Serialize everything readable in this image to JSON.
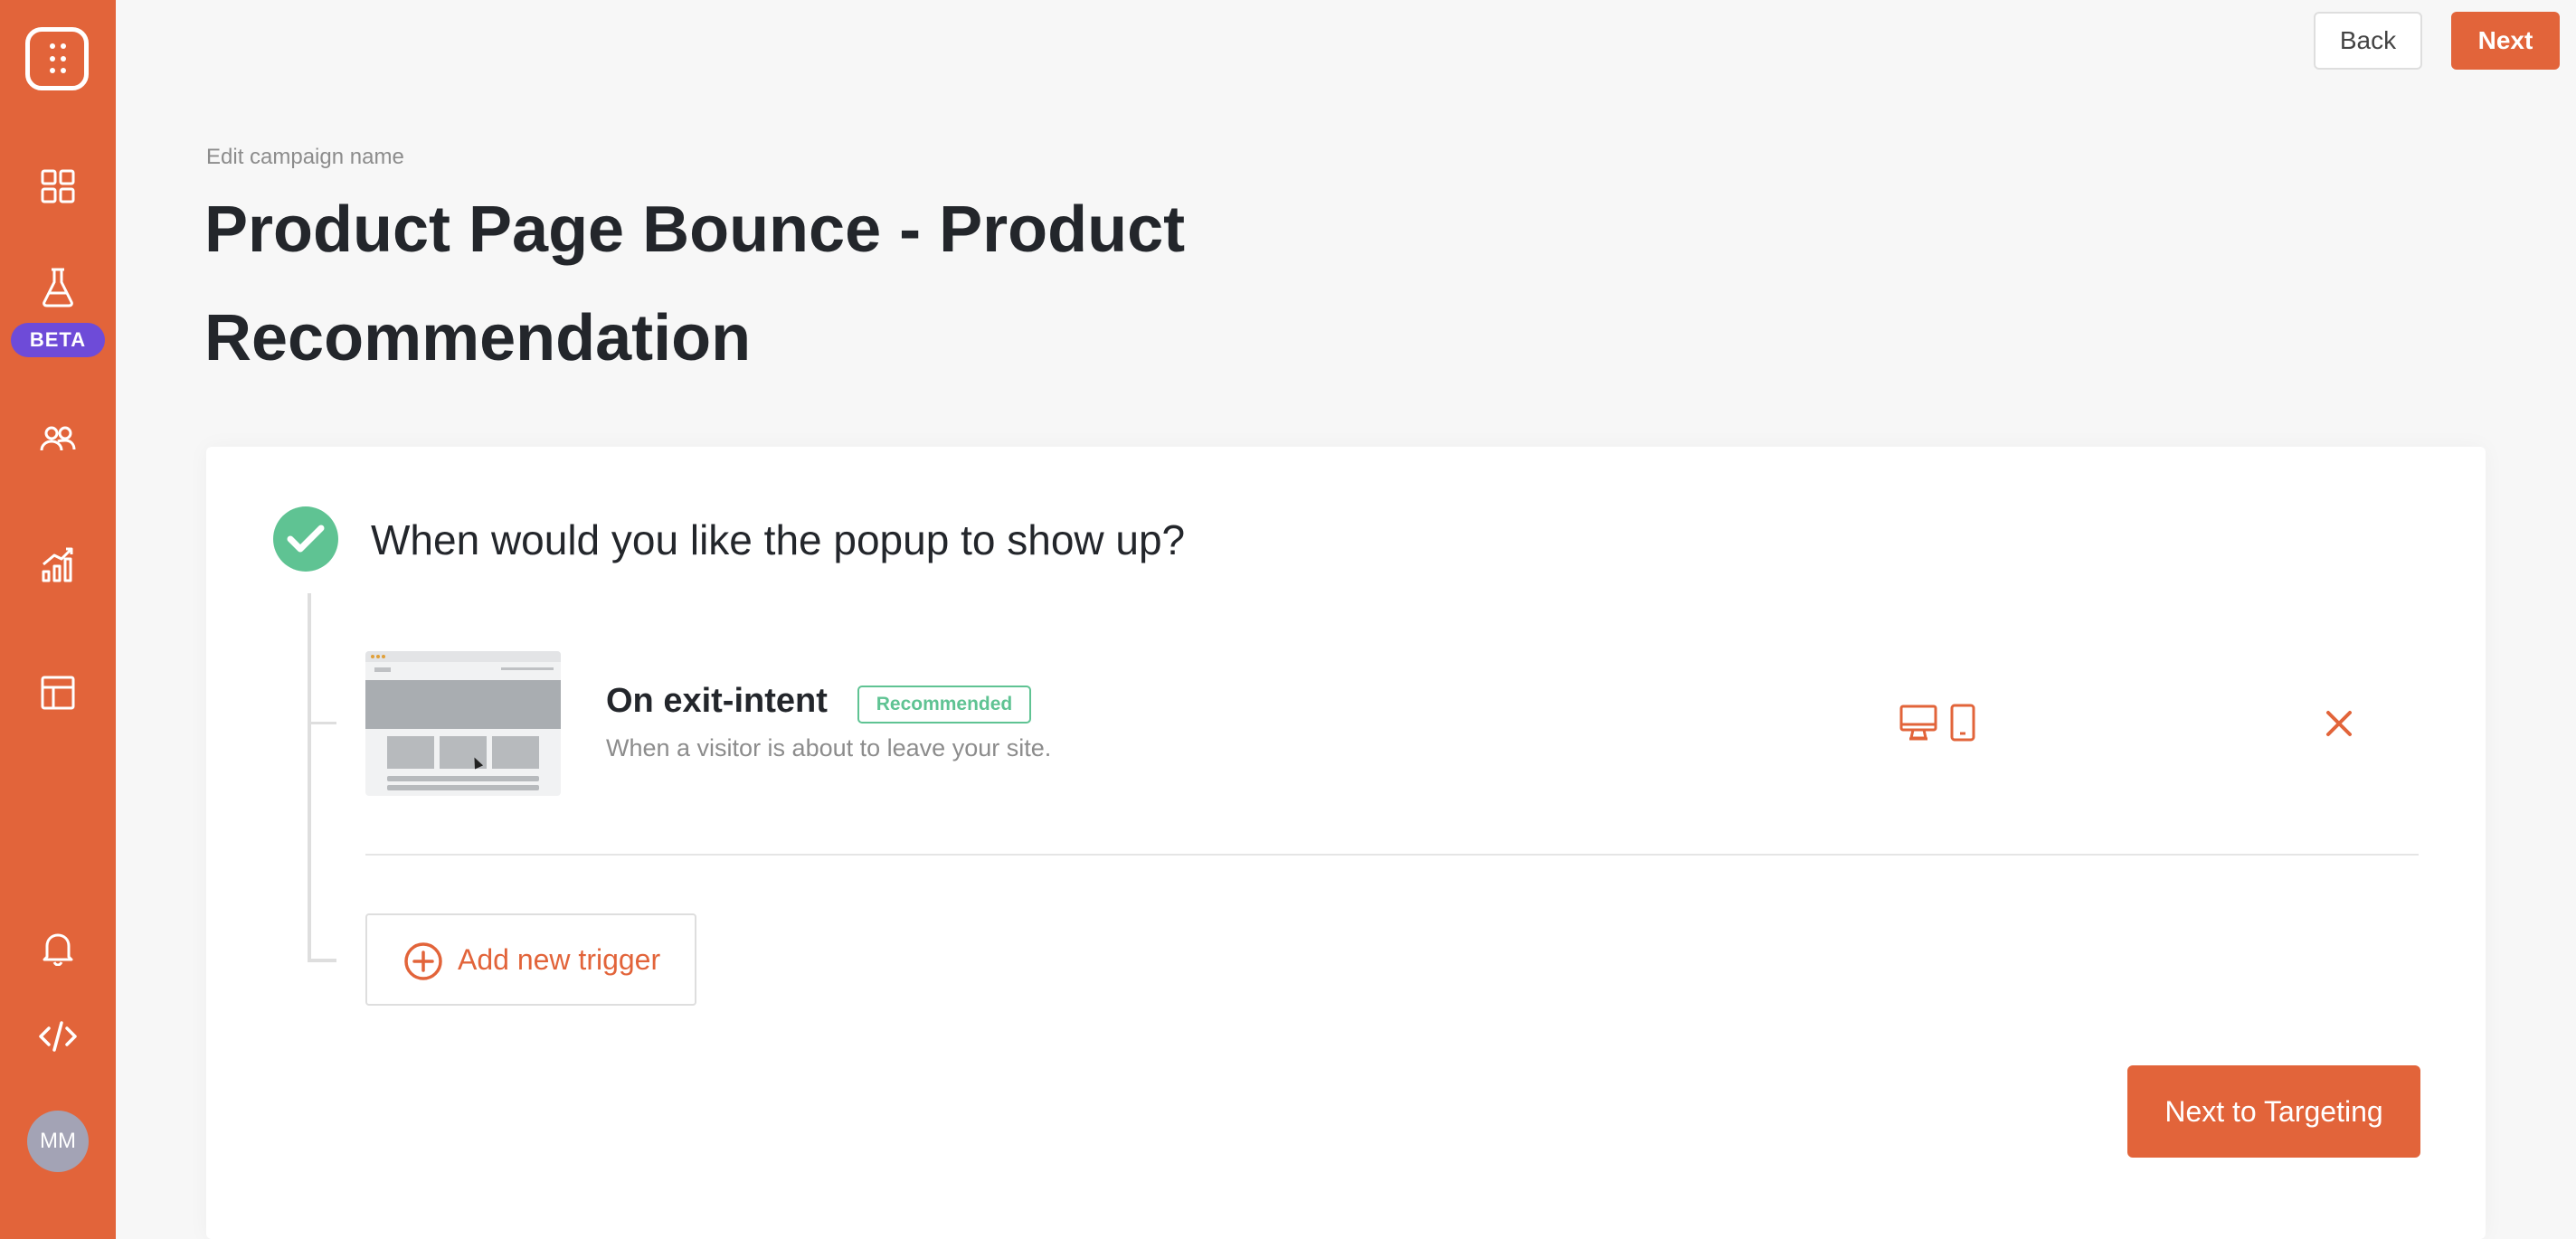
{
  "sidebar": {
    "items": [
      {
        "icon": "dashboard-grid-icon"
      },
      {
        "icon": "flask-icon",
        "badge": "BETA"
      },
      {
        "icon": "users-icon"
      },
      {
        "icon": "analytics-chart-icon"
      },
      {
        "icon": "templates-layout-icon"
      },
      {
        "icon": "bell-icon"
      },
      {
        "icon": "code-icon"
      }
    ],
    "avatar_initials": "MM"
  },
  "header": {
    "back_label": "Back",
    "next_label": "Next",
    "edit_campaign_label": "Edit campaign name",
    "title": "Product Page Bounce - Product Recommendation"
  },
  "card": {
    "question": "When would you like the popup to show up?",
    "trigger": {
      "title": "On exit-intent",
      "badge": "Recommended",
      "description": "When a visitor is about to leave your site.",
      "devices": [
        "desktop-icon",
        "mobile-icon"
      ]
    },
    "add_trigger_label": "Add new trigger",
    "next_targeting_label": "Next to Targeting"
  },
  "colors": {
    "accent": "#e2643a",
    "success": "#5fc393",
    "beta": "#6e4bd8"
  }
}
